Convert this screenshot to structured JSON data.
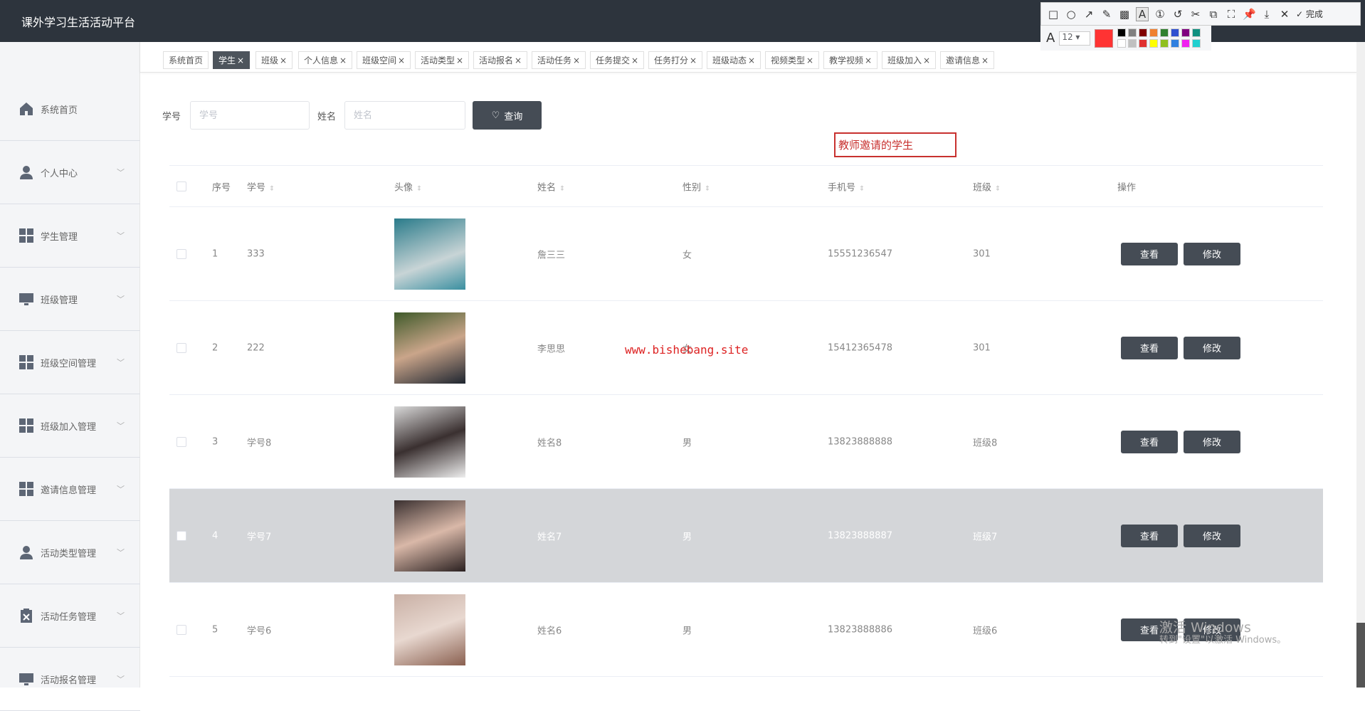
{
  "app_title": "课外学习生活活动平台",
  "sidebar": [
    {
      "label": "系统首页",
      "icon": "home-icon",
      "chevron": false
    },
    {
      "label": "个人中心",
      "icon": "user-icon",
      "chevron": true
    },
    {
      "label": "学生管理",
      "icon": "grid-icon",
      "chevron": true
    },
    {
      "label": "班级管理",
      "icon": "monitor-icon",
      "chevron": true
    },
    {
      "label": "班级空间管理",
      "icon": "grid-icon",
      "chevron": true
    },
    {
      "label": "班级加入管理",
      "icon": "grid-icon",
      "chevron": true
    },
    {
      "label": "邀请信息管理",
      "icon": "grid-icon",
      "chevron": true
    },
    {
      "label": "活动类型管理",
      "icon": "user-icon",
      "chevron": true
    },
    {
      "label": "活动任务管理",
      "icon": "clipboard-icon",
      "chevron": true
    },
    {
      "label": "活动报名管理",
      "icon": "monitor-icon",
      "chevron": true
    }
  ],
  "tabs": [
    {
      "label": "系统首页",
      "closable": false
    },
    {
      "label": "学生",
      "closable": true,
      "active": true
    },
    {
      "label": "班级",
      "closable": true
    },
    {
      "label": "个人信息",
      "closable": true
    },
    {
      "label": "班级空间",
      "closable": true
    },
    {
      "label": "活动类型",
      "closable": true
    },
    {
      "label": "活动报名",
      "closable": true
    },
    {
      "label": "活动任务",
      "closable": true
    },
    {
      "label": "任务提交",
      "closable": true
    },
    {
      "label": "任务打分",
      "closable": true
    },
    {
      "label": "班级动态",
      "closable": true
    },
    {
      "label": "视频类型",
      "closable": true
    },
    {
      "label": "教学视频",
      "closable": true
    },
    {
      "label": "班级加入",
      "closable": true
    },
    {
      "label": "邀请信息",
      "closable": true
    }
  ],
  "search": {
    "id_label": "学号",
    "id_placeholder": "学号",
    "name_label": "姓名",
    "name_placeholder": "姓名",
    "button": "查询"
  },
  "annotation_text": "教师邀请的学生",
  "table": {
    "headers": {
      "index": "序号",
      "id": "学号",
      "avatar": "头像",
      "name": "姓名",
      "gender": "性别",
      "phone": "手机号",
      "class": "班级",
      "actions": "操作"
    },
    "view_label": "查看",
    "edit_label": "修改",
    "rows": [
      {
        "index": "1",
        "id": "333",
        "name": "詹三三",
        "gender": "女",
        "phone": "15551236547",
        "class": "301"
      },
      {
        "index": "2",
        "id": "222",
        "name": "李思思",
        "gender": "女",
        "phone": "15412365478",
        "class": "301"
      },
      {
        "index": "3",
        "id": "学号8",
        "name": "姓名8",
        "gender": "男",
        "phone": "13823888888",
        "class": "班级8"
      },
      {
        "index": "4",
        "id": "学号7",
        "name": "姓名7",
        "gender": "男",
        "phone": "13823888887",
        "class": "班级7",
        "highlighted": true
      },
      {
        "index": "5",
        "id": "学号6",
        "name": "姓名6",
        "gender": "男",
        "phone": "13823888886",
        "class": "班级6"
      }
    ]
  },
  "watermark": "www.bishebang.site",
  "windows_activation": {
    "title": "激活 Windows",
    "subtitle": "转到\"设置\"以激活 Windows。"
  },
  "snip_toolbar": {
    "done_label": "完成",
    "font_size": "12",
    "current_color": "#ff3333",
    "palette": [
      "#000000",
      "#808080",
      "#800000",
      "#f08030",
      "#308030",
      "#3050d0",
      "#800080",
      "#109080",
      "#ffffff",
      "#c0c0c0",
      "#e03030",
      "#ffff00",
      "#90c020",
      "#3080e0",
      "#f020f0",
      "#20d0d0"
    ]
  }
}
